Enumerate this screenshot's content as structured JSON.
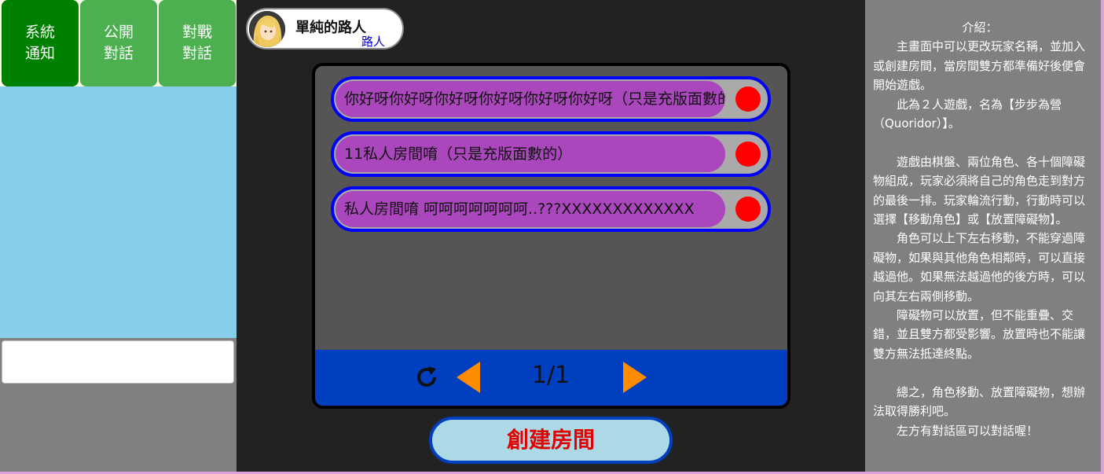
{
  "left": {
    "tabs": [
      {
        "label": "系統\n通知",
        "active": true
      },
      {
        "label": "公開\n對話",
        "active": false
      },
      {
        "label": "對戰\n對話",
        "active": false
      }
    ],
    "chat_input": {
      "value": "",
      "placeholder": ""
    }
  },
  "profile": {
    "name": "單純的路人",
    "rank": "路人"
  },
  "rooms": [
    {
      "title": "你好呀你好呀你好呀你好呀你好呀你好呀（只是充版面數的）",
      "status_color": "#ff0000"
    },
    {
      "title": "11私人房間唷（只是充版面數的）",
      "status_color": "#ff0000"
    },
    {
      "title": "私人房間唷 呵呵呵呵呵呵呵..???XXXXXXXXXXXXX",
      "status_color": "#ff0000"
    }
  ],
  "pager": {
    "page": "1/1",
    "refresh_icon": "refresh-icon",
    "prev_icon": "triangle-left-icon",
    "next_icon": "triangle-right-icon"
  },
  "create_button": {
    "label": "創建房間"
  },
  "intro": {
    "title": "介紹：",
    "paragraphs": [
      "主畫面中可以更改玩家名稱，並加入或創建房間，當房間雙方都準備好後便會開始遊戲。",
      "此為２人遊戲，名為【步步為營（Quoridor）】。",
      "",
      "遊戲由棋盤、兩位角色、各十個障礙物組成，玩家必須將自己的角色走到對方的最後一排。玩家輪流行動，行動時可以選擇【移動角色】或【放置障礙物】。",
      "角色可以上下左右移動，不能穿過障礙物，如果與其他角色相鄰時，可以直接越過他。如果無法越過他的後方時，可以向其左右兩側移動。",
      "障礙物可以放置，但不能重疊、交錯，並且雙方都受影響。放置時也不能讓雙方無法抵達終點。",
      "",
      "總之，角色移動、放置障礙物，想辦法取得勝利吧。",
      "左方有對話區可以對話喔！"
    ]
  },
  "colors": {
    "tab_active": "#008000",
    "tab": "#4caf50",
    "chat_bg": "#87ceeb",
    "room_title_bg": "#ab47bc",
    "room_border": "#0000ff",
    "pager_bg": "#0040c0",
    "arrow": "#ff8c00",
    "create_text": "#e00000",
    "create_bg": "#add8e6"
  }
}
